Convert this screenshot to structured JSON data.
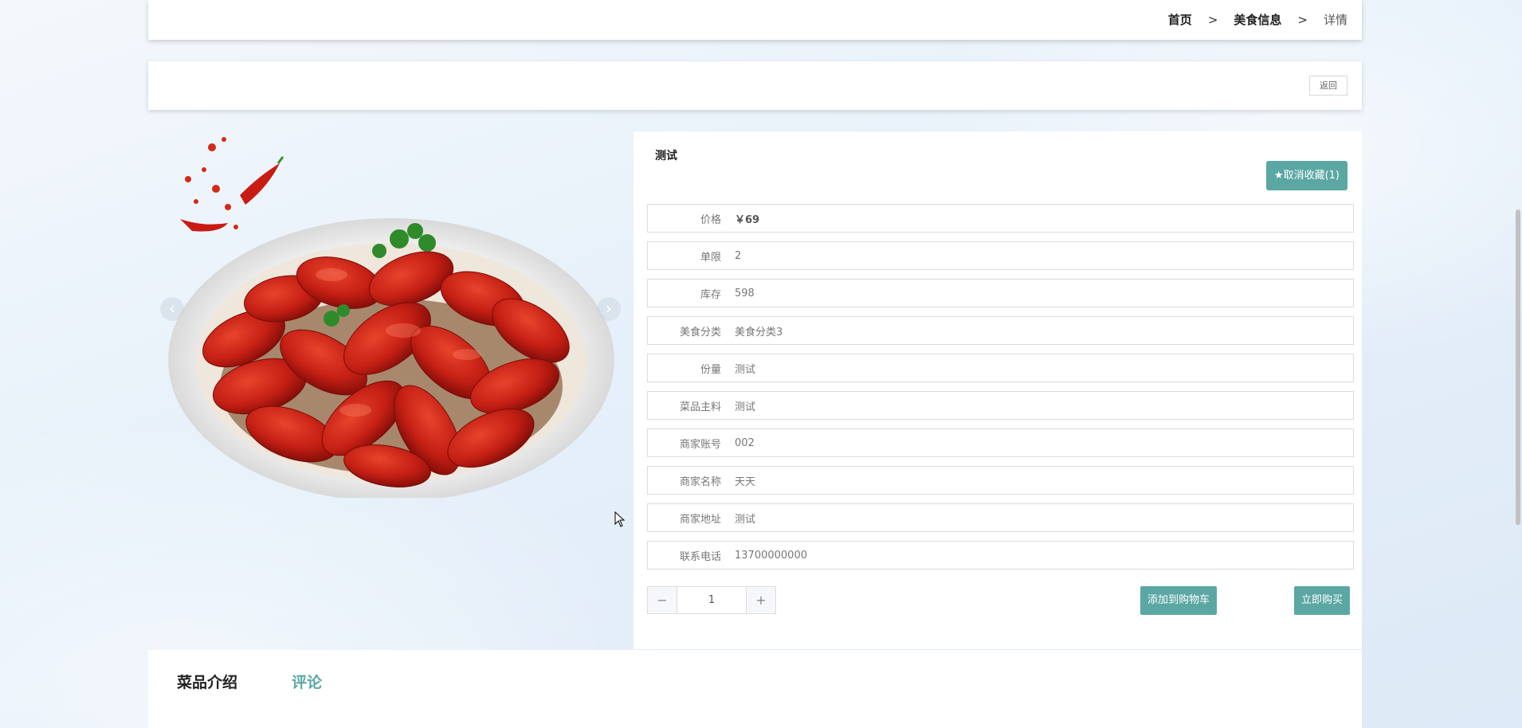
{
  "breadcrumb": {
    "home": "首页",
    "sep1": ">",
    "category": "美食信息",
    "sep2": ">",
    "current": "详情"
  },
  "back_label": "返回",
  "gallery": {
    "prev_icon": "chevron-left-icon",
    "next_icon": "chevron-right-icon",
    "prev_glyph": "‹",
    "next_glyph": "›"
  },
  "detail": {
    "title": "测试",
    "favorite_label": "★取消收藏(1)",
    "fields": [
      {
        "label": "价格",
        "value": "￥69"
      },
      {
        "label": "单限",
        "value": "2"
      },
      {
        "label": "库存",
        "value": "598"
      },
      {
        "label": "美食分类",
        "value": "美食分类3"
      },
      {
        "label": "份量",
        "value": "测试"
      },
      {
        "label": "菜品主料",
        "value": "测试"
      },
      {
        "label": "商家账号",
        "value": "002"
      },
      {
        "label": "商家名称",
        "value": "天天"
      },
      {
        "label": "商家地址",
        "value": "测试"
      },
      {
        "label": "联系电话",
        "value": "13700000000"
      }
    ],
    "quantity": "1",
    "minus_glyph": "−",
    "plus_glyph": "+",
    "add_to_cart_label": "添加到购物车",
    "buy_now_label": "立即购买"
  },
  "tabs": {
    "intro": "菜品介绍",
    "comment": "评论"
  },
  "colors": {
    "accent": "#5ba7a3"
  }
}
